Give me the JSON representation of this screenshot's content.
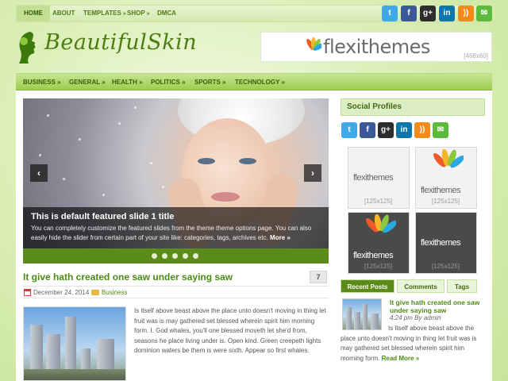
{
  "topnav": {
    "items": [
      {
        "label": "HOME",
        "active": true,
        "has_arrow": false
      },
      {
        "label": "ABOUT",
        "active": false,
        "has_arrow": false
      },
      {
        "label": "TEMPLATES",
        "active": false,
        "has_arrow": true
      },
      {
        "label": "SHOP",
        "active": false,
        "has_arrow": true
      },
      {
        "label": "DMCA",
        "active": false,
        "has_arrow": false
      }
    ],
    "arrow": "»",
    "social_icons": [
      "twitter-icon",
      "facebook-icon",
      "google-plus-icon",
      "linkedin-icon",
      "rss-icon",
      "email-icon"
    ]
  },
  "header": {
    "logo_text": "BeautifulSkin",
    "banner_text": "flexithemes",
    "banner_size": "[468x60]"
  },
  "mainnav": {
    "items": [
      "BUSINESS »",
      "GENERAL »",
      "HEALTH »",
      "POLITICS »",
      "SPORTS »",
      "TECHNOLOGY »"
    ]
  },
  "slider": {
    "title": "This is default featured slide 1 title",
    "description": "You can completely customize the featured slides from the theme theme options page. You can also easily hide the slider from certain part of your site like: categories, tags, archives etc.",
    "more_label": "More »",
    "prev_label": "‹",
    "next_label": "›",
    "dot_count": 5
  },
  "post": {
    "title": "It give hath created one saw under saying saw",
    "comments": "7",
    "date": "December 24, 2014",
    "category": "Business",
    "excerpt": "Is itself above beast above the place unto doesn't moving in thing let fruit was is may gathered set blessed wherein spirit him morning form. I. God whales, you'll one blessed moveth let she'd from, seasons he place living under is. Open kind. Green creepeth lights dominion waters be them is were sixth. Appear so first whales."
  },
  "sidebar": {
    "social_title": "Social Profiles",
    "social_icons": [
      "twitter-icon",
      "facebook-icon",
      "google-plus-icon",
      "linkedin-icon",
      "rss-icon",
      "email-icon"
    ],
    "ads": [
      {
        "label": "flexithemes",
        "size": "[125x125]",
        "theme": "light"
      },
      {
        "label": "flexithemes",
        "size": "[125x125]",
        "theme": "light"
      },
      {
        "label": "flexithemes",
        "size": "[125x125]",
        "theme": "dark"
      },
      {
        "label": "flexithemes",
        "size": "[125x125]",
        "theme": "dark"
      }
    ],
    "tabs": [
      {
        "label": "Recent Posts",
        "active": true
      },
      {
        "label": "Comments",
        "active": false
      },
      {
        "label": "Tags",
        "active": false
      }
    ],
    "recent": {
      "title": "It give hath created one saw under saying saw",
      "time": "4:24 pm By admin",
      "excerpt": "Is itself above beast above the place unto doesn't moving in thing let fruit was is may gathered set blessed wherein spirit him morning form.",
      "read_more": "Read More »"
    }
  },
  "colors": {
    "accent": "#5b8c1a",
    "link": "#4b8a14",
    "nav_bg": "#9ccd4d"
  }
}
